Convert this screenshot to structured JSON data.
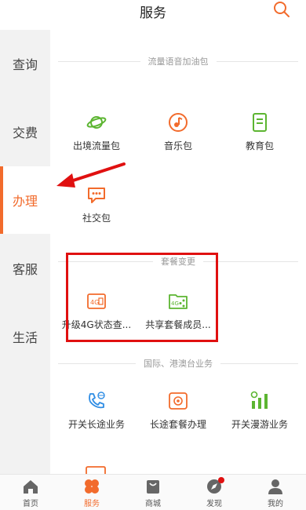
{
  "header": {
    "title": "服务"
  },
  "sidebar": {
    "items": [
      {
        "label": "查询"
      },
      {
        "label": "交费"
      },
      {
        "label": "办理"
      },
      {
        "label": "客服"
      },
      {
        "label": "生活"
      }
    ],
    "active_index": 2
  },
  "sections": [
    {
      "title": "流量语音加油包",
      "items": [
        {
          "label": "出境流量包",
          "icon": "planet-icon"
        },
        {
          "label": "音乐包",
          "icon": "music-icon"
        },
        {
          "label": "教育包",
          "icon": "book-icon"
        },
        {
          "label": "社交包",
          "icon": "chat-icon"
        }
      ]
    },
    {
      "title": "套餐变更",
      "items": [
        {
          "label": "升级4G状态查...",
          "icon": "4g-sim-icon"
        },
        {
          "label": "共享套餐成员...",
          "icon": "4g-share-icon"
        }
      ]
    },
    {
      "title": "国际、港澳台业务",
      "items": [
        {
          "label": "开关长途业务",
          "icon": "phone-globe-icon"
        },
        {
          "label": "长途套餐办理",
          "icon": "phone-plan-icon"
        },
        {
          "label": "开关漫游业务",
          "icon": "roaming-icon"
        }
      ]
    }
  ],
  "tabbar": {
    "items": [
      {
        "label": "首页",
        "icon": "home-icon"
      },
      {
        "label": "服务",
        "icon": "service-icon"
      },
      {
        "label": "商城",
        "icon": "shop-bag-icon"
      },
      {
        "label": "发现",
        "icon": "compass-icon"
      },
      {
        "label": "我的",
        "icon": "user-icon"
      }
    ],
    "active_index": 1
  },
  "colors": {
    "accent": "#f26b2c",
    "green": "#5cb531",
    "blue": "#2f8de4",
    "annotation": "#e01010"
  }
}
